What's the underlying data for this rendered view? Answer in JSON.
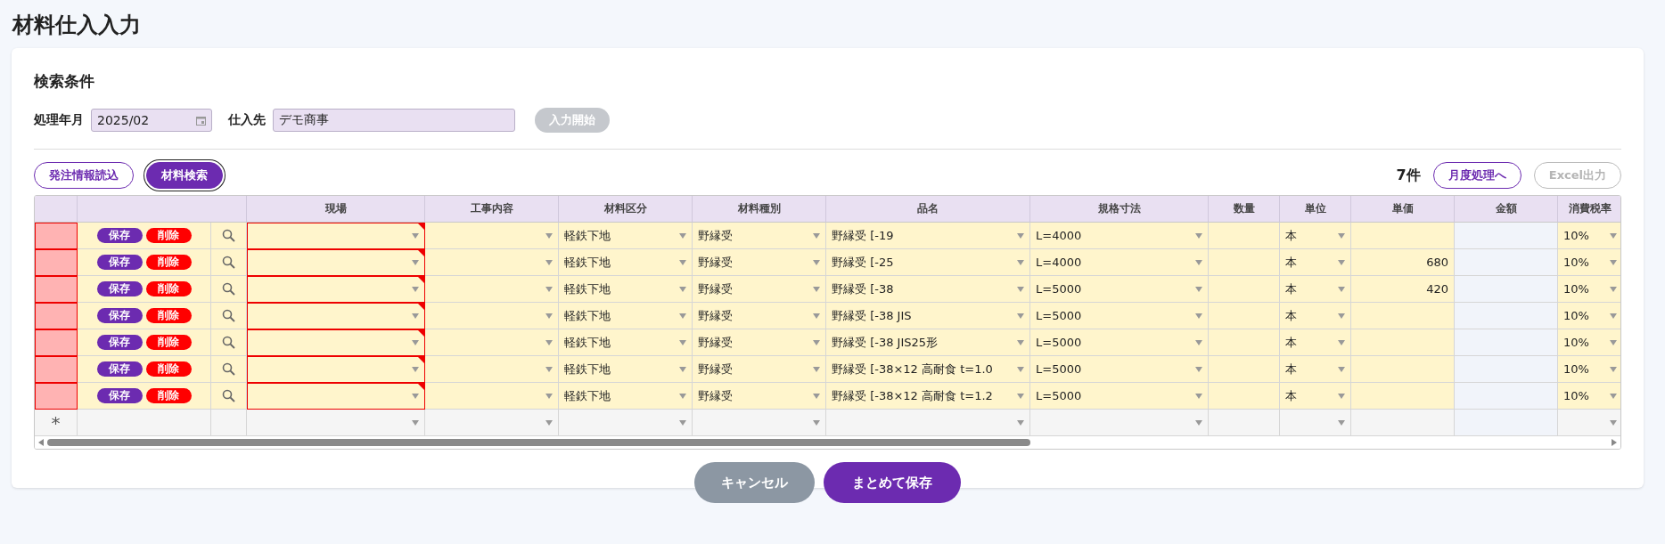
{
  "page_title": "材料仕入入力",
  "search": {
    "title": "検索条件",
    "fields": [
      {
        "label": "処理年月",
        "value": "2025/02",
        "kind": "month"
      },
      {
        "label": "仕入先",
        "value": "デモ商事",
        "kind": "text"
      }
    ],
    "start_button": {
      "label": "入力開始",
      "disabled": true
    }
  },
  "toolbar": {
    "left_buttons": [
      {
        "label": "発注情報読込",
        "focused": false
      },
      {
        "label": "材料検索",
        "focused": true
      }
    ],
    "count": "7件",
    "right_buttons": [
      {
        "label": "月度処理へ",
        "disabled": false
      },
      {
        "label": "Excel出力",
        "disabled": true
      }
    ]
  },
  "table": {
    "columns": [
      {
        "label": "現場",
        "kind": "select"
      },
      {
        "label": "工事内容",
        "kind": "select"
      },
      {
        "label": "材料区分",
        "kind": "select"
      },
      {
        "label": "材料種別",
        "kind": "select"
      },
      {
        "label": "品名",
        "kind": "select"
      },
      {
        "label": "規格寸法",
        "kind": "select"
      },
      {
        "label": "数量",
        "kind": "number"
      },
      {
        "label": "単位",
        "kind": "select"
      },
      {
        "label": "単価",
        "kind": "number"
      },
      {
        "label": "金額",
        "kind": "readonly"
      },
      {
        "label": "消費税率",
        "kind": "select"
      }
    ],
    "rows": [
      {
        "invalid": true,
        "save": "保存",
        "delete": "削除",
        "cells": [
          null,
          null,
          "軽鉄下地",
          "野縁受",
          "野縁受 [-19",
          "L=4000",
          null,
          "本",
          null,
          null,
          "10%"
        ]
      },
      {
        "invalid": true,
        "save": "保存",
        "delete": "削除",
        "cells": [
          null,
          null,
          "軽鉄下地",
          "野縁受",
          "野縁受 [-25",
          "L=4000",
          null,
          "本",
          "680",
          null,
          "10%"
        ]
      },
      {
        "invalid": true,
        "save": "保存",
        "delete": "削除",
        "cells": [
          null,
          null,
          "軽鉄下地",
          "野縁受",
          "野縁受 [-38",
          "L=5000",
          null,
          "本",
          "420",
          null,
          "10%"
        ]
      },
      {
        "invalid": true,
        "save": "保存",
        "delete": "削除",
        "cells": [
          null,
          null,
          "軽鉄下地",
          "野縁受",
          "野縁受 [-38 JIS",
          "L=5000",
          null,
          "本",
          null,
          null,
          "10%"
        ]
      },
      {
        "invalid": true,
        "save": "保存",
        "delete": "削除",
        "cells": [
          null,
          null,
          "軽鉄下地",
          "野縁受",
          "野縁受 [-38 JIS25形",
          "L=5000",
          null,
          "本",
          null,
          null,
          "10%"
        ]
      },
      {
        "invalid": true,
        "save": "保存",
        "delete": "削除",
        "cells": [
          null,
          null,
          "軽鉄下地",
          "野縁受",
          "野縁受 [-38×12 高耐食 t=1.0",
          "L=5000",
          null,
          "本",
          null,
          null,
          "10%"
        ]
      },
      {
        "invalid": true,
        "save": "保存",
        "delete": "削除",
        "cells": [
          null,
          null,
          "軽鉄下地",
          "野縁受",
          "野縁受 [-38×12 高耐食 t=1.2",
          "L=5000",
          null,
          "本",
          null,
          null,
          "10%"
        ]
      }
    ],
    "new_row": {
      "marker": "*"
    }
  },
  "footer": {
    "buttons": [
      {
        "label": "キャンセル"
      },
      {
        "label": "まとめて保存"
      }
    ]
  }
}
